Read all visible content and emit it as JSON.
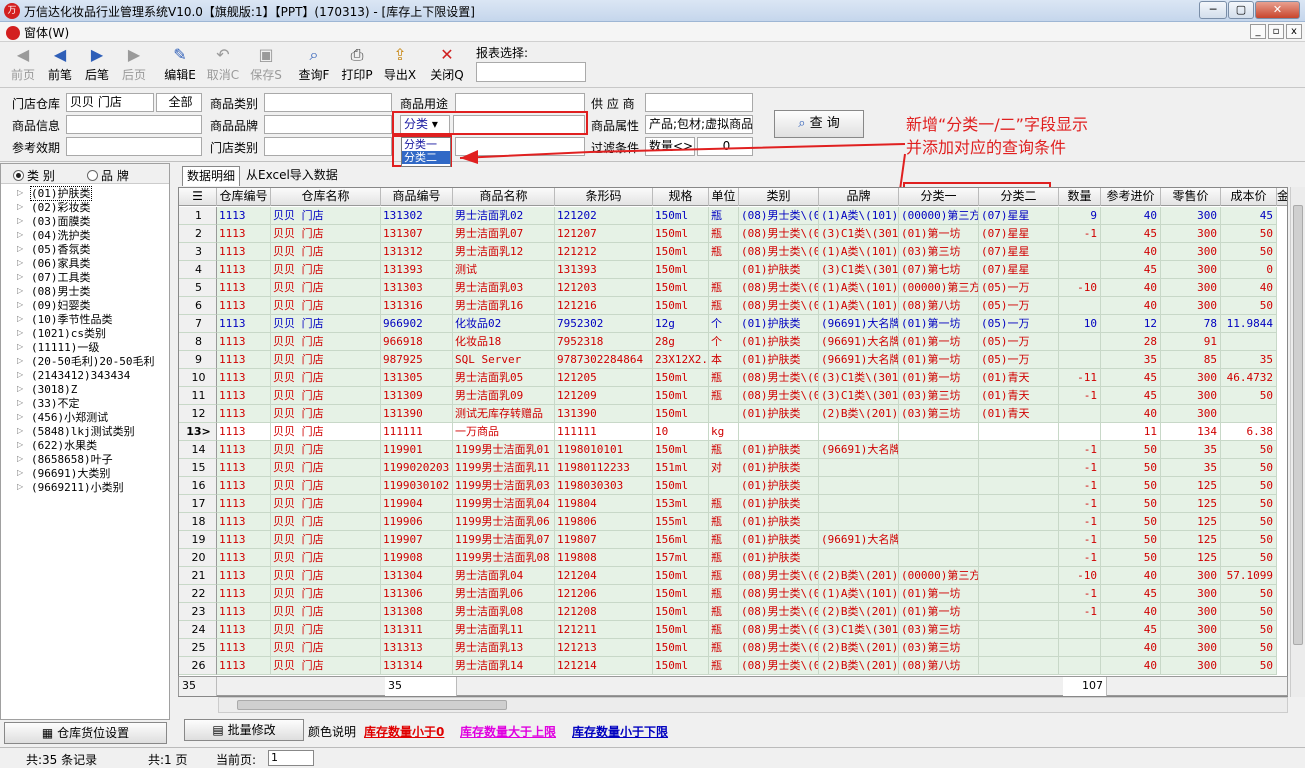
{
  "window": {
    "title": "万信达化妆品行业管理系统V10.0【旗舰版:1】【PPT】(170313) - [库存上下限设置]",
    "controls": [
      "─",
      "▢",
      "✕"
    ]
  },
  "menu": {
    "label": "窗体(W)"
  },
  "toolbar": {
    "buttons": [
      {
        "label": "前页",
        "icon": "first-page-icon"
      },
      {
        "label": "前笔",
        "icon": "prev-icon"
      },
      {
        "label": "后笔",
        "icon": "next-icon"
      },
      {
        "label": "后页",
        "icon": "last-page-icon"
      },
      {
        "label": "编辑E",
        "icon": "edit-icon"
      },
      {
        "label": "取消C",
        "icon": "undo-icon"
      },
      {
        "label": "保存S",
        "icon": "save-icon"
      },
      {
        "label": "查询F",
        "icon": "search-icon"
      },
      {
        "label": "打印P",
        "icon": "print-icon"
      },
      {
        "label": "导出X",
        "icon": "export-icon"
      },
      {
        "label": "关闭Q",
        "icon": "close-icon"
      }
    ],
    "report_label": "报表选择:"
  },
  "filters": {
    "store_label": "门店仓库",
    "store_value": "贝贝 门店",
    "store_all": "全部",
    "goods_info_label": "商品信息",
    "ref_effect_label": "参考效期",
    "category_label": "商品类别",
    "brand_label": "商品品牌",
    "door_category_label": "门店类别",
    "usage_label": "商品用途",
    "class_select_value": "分类",
    "supplier_label": "供 应 商",
    "attr_label": "商品属性",
    "attr_value": "产品;包材;虚拟商品",
    "filter_label": "过滤条件",
    "filter_field": "数量<>",
    "filter_value": "0",
    "query_button": "查 询",
    "dropdown_options": [
      "分类一",
      "分类二"
    ]
  },
  "annotation": {
    "line1": "新增“分类一/二”字段显示",
    "line2": "并添加对应的查询条件"
  },
  "left_panel": {
    "radio_category": "类 别",
    "radio_brand": "品 牌",
    "tree": [
      "(01)护肤类",
      "(02)彩妆类",
      "(03)面膜类",
      "(04)洗护类",
      "(05)香氛类",
      "(06)家具类",
      "(07)工具类",
      "(08)男士类",
      "(09)妇婴类",
      "(10)季节性品类",
      "(1021)cs类别",
      "(11111)一级",
      "(20-50毛利)20-50毛利",
      "(2143412)343434",
      "(3018)Z",
      "(33)不定",
      "(456)小郑测试",
      "(5848)lkj测试类别",
      "(622)水果类",
      "(8658658)叶子",
      "(96691)大类别",
      "(9669211)小类别"
    ],
    "warehouse_button": "仓库货位设置"
  },
  "tabs": [
    "数据明细",
    "从Excel导入数据"
  ],
  "grid": {
    "headers": [
      "仓库编号",
      "仓库名称",
      "商品编号",
      "商品名称",
      "条形码",
      "规格",
      "单位",
      "类别",
      "品牌",
      "分类一",
      "分类二",
      "数量",
      "参考进价",
      "零售价",
      "成本价",
      "金"
    ],
    "rows": [
      [
        "1",
        "1113",
        "贝贝 门店",
        "131302",
        "男士洁面乳02",
        "121202",
        "150ml",
        "瓶",
        "(08)男士类\\(0",
        "(1)A类\\(101)E",
        "(00000)第三方",
        "(07)星星",
        "9",
        "40",
        "300",
        "45"
      ],
      [
        "2",
        "1113",
        "贝贝 门店",
        "131307",
        "男士洁面乳07",
        "121207",
        "150ml",
        "瓶",
        "(08)男士类\\(0",
        "(3)C1类\\(301",
        "(01)第一坊",
        "(07)星星",
        "-1",
        "45",
        "300",
        "50"
      ],
      [
        "3",
        "1113",
        "贝贝 门店",
        "131312",
        "男士洁面乳12",
        "121212",
        "150ml",
        "瓶",
        "(08)男士类\\(0",
        "(1)A类\\(101)E",
        "(03)第三坊",
        "(07)星星",
        "",
        "40",
        "300",
        "50"
      ],
      [
        "4",
        "1113",
        "贝贝 门店",
        "131393",
        "测试",
        "131393",
        "150ml",
        "",
        "(01)护肤类",
        "(3)C1类\\(301",
        "(07)第七坊",
        "(07)星星",
        "",
        "45",
        "300",
        "0"
      ],
      [
        "5",
        "1113",
        "贝贝 门店",
        "131303",
        "男士洁面乳03",
        "121203",
        "150ml",
        "瓶",
        "(08)男士类\\(0",
        "(1)A类\\(101)E",
        "(00000)第三方",
        "(05)一万",
        "-10",
        "40",
        "300",
        "40"
      ],
      [
        "6",
        "1113",
        "贝贝 门店",
        "131316",
        "男士洁面乳16",
        "121216",
        "150ml",
        "瓶",
        "(08)男士类\\(0",
        "(1)A类\\(101)E",
        "(08)第八坊",
        "(05)一万",
        "",
        "40",
        "300",
        "50"
      ],
      [
        "7",
        "1113",
        "贝贝 门店",
        "966902",
        "化妆品02",
        "7952302",
        "12g",
        "个",
        "(01)护肤类",
        "(96691)大名牌",
        "(01)第一坊",
        "(05)一万",
        "10",
        "12",
        "78",
        "11.9844"
      ],
      [
        "8",
        "1113",
        "贝贝 门店",
        "966918",
        "化妆品18",
        "7952318",
        "28g",
        "个",
        "(01)护肤类",
        "(96691)大名牌",
        "(01)第一坊",
        "(05)一万",
        "",
        "28",
        "91",
        ""
      ],
      [
        "9",
        "1113",
        "贝贝 门店",
        "987925",
        "SQL Server",
        "9787302284864",
        "23X12X2.6",
        "本",
        "(01)护肤类",
        "(96691)大名牌",
        "(01)第一坊",
        "(05)一万",
        "",
        "35",
        "85",
        "35"
      ],
      [
        "10",
        "1113",
        "贝贝 门店",
        "131305",
        "男士洁面乳05",
        "121205",
        "150ml",
        "瓶",
        "(08)男士类\\(0",
        "(3)C1类\\(301",
        "(01)第一坊",
        "(01)青天",
        "-11",
        "45",
        "300",
        "46.4732"
      ],
      [
        "11",
        "1113",
        "贝贝 门店",
        "131309",
        "男士洁面乳09",
        "121209",
        "150ml",
        "瓶",
        "(08)男士类\\(0",
        "(3)C1类\\(301",
        "(03)第三坊",
        "(01)青天",
        "-1",
        "45",
        "300",
        "50"
      ],
      [
        "12",
        "1113",
        "贝贝 门店",
        "131390",
        "测试无库存转赠品",
        "131390",
        "150ml",
        "",
        "(01)护肤类",
        "(2)B类\\(201)",
        "(03)第三坊",
        "(01)青天",
        "",
        "40",
        "300",
        ""
      ],
      [
        "13>",
        "1113",
        "贝贝 门店",
        "111111",
        "一万商品",
        "111111",
        "10",
        "kg",
        "",
        "",
        "",
        "",
        "",
        "11",
        "134",
        "6.38"
      ],
      [
        "14",
        "1113",
        "贝贝 门店",
        "119901",
        "1199男士洁面乳01",
        "1198010101",
        "150ml",
        "瓶",
        "(01)护肤类",
        "(96691)大名牌",
        "",
        "",
        "-1",
        "50",
        "35",
        "50"
      ],
      [
        "15",
        "1113",
        "贝贝 门店",
        "1199020203",
        "1199男士洁面乳11",
        "11980112233",
        "151ml",
        "对",
        "(01)护肤类",
        "",
        "",
        "",
        "-1",
        "50",
        "35",
        "50"
      ],
      [
        "16",
        "1113",
        "贝贝 门店",
        "1199030102",
        "1199男士洁面乳03",
        "1198030303",
        "150ml",
        "",
        "(01)护肤类",
        "",
        "",
        "",
        "-1",
        "50",
        "125",
        "50"
      ],
      [
        "17",
        "1113",
        "贝贝 门店",
        "119904",
        "1199男士洁面乳04",
        "119804",
        "153ml",
        "瓶",
        "(01)护肤类",
        "",
        "",
        "",
        "-1",
        "50",
        "125",
        "50"
      ],
      [
        "18",
        "1113",
        "贝贝 门店",
        "119906",
        "1199男士洁面乳06",
        "119806",
        "155ml",
        "瓶",
        "(01)护肤类",
        "",
        "",
        "",
        "-1",
        "50",
        "125",
        "50"
      ],
      [
        "19",
        "1113",
        "贝贝 门店",
        "119907",
        "1199男士洁面乳07",
        "119807",
        "156ml",
        "瓶",
        "(01)护肤类",
        "(96691)大名牌",
        "",
        "",
        "-1",
        "50",
        "125",
        "50"
      ],
      [
        "20",
        "1113",
        "贝贝 门店",
        "119908",
        "1199男士洁面乳08",
        "119808",
        "157ml",
        "瓶",
        "(01)护肤类",
        "",
        "",
        "",
        "-1",
        "50",
        "125",
        "50"
      ],
      [
        "21",
        "1113",
        "贝贝 门店",
        "131304",
        "男士洁面乳04",
        "121204",
        "150ml",
        "瓶",
        "(08)男士类\\(0",
        "(2)B类\\(201)",
        "(00000)第三方",
        "",
        "-10",
        "40",
        "300",
        "57.1099"
      ],
      [
        "22",
        "1113",
        "贝贝 门店",
        "131306",
        "男士洁面乳06",
        "121206",
        "150ml",
        "瓶",
        "(08)男士类\\(0",
        "(1)A类\\(101)E",
        "(01)第一坊",
        "",
        "-1",
        "45",
        "300",
        "50"
      ],
      [
        "23",
        "1113",
        "贝贝 门店",
        "131308",
        "男士洁面乳08",
        "121208",
        "150ml",
        "瓶",
        "(08)男士类\\(0",
        "(2)B类\\(201)",
        "(01)第一坊",
        "",
        "-1",
        "40",
        "300",
        "50"
      ],
      [
        "24",
        "1113",
        "贝贝 门店",
        "131311",
        "男士洁面乳11",
        "121211",
        "150ml",
        "瓶",
        "(08)男士类\\(0",
        "(3)C1类\\(301",
        "(03)第三坊",
        "",
        "",
        "45",
        "300",
        "50"
      ],
      [
        "25",
        "1113",
        "贝贝 门店",
        "131313",
        "男士洁面乳13",
        "121213",
        "150ml",
        "瓶",
        "(08)男士类\\(0",
        "(2)B类\\(201)",
        "(03)第三坊",
        "",
        "",
        "40",
        "300",
        "50"
      ],
      [
        "26",
        "1113",
        "贝贝 门店",
        "131314",
        "男士洁面乳14",
        "121214",
        "150ml",
        "瓶",
        "(08)男士类\\(0",
        "(2)B类\\(201)",
        "(08)第八坊",
        "",
        "",
        "40",
        "300",
        "50"
      ]
    ],
    "row_colors": [
      "blue",
      "red",
      "red",
      "red",
      "red",
      "red",
      "blue",
      "red",
      "red",
      "red",
      "red",
      "red",
      "red",
      "red",
      "red",
      "red",
      "red",
      "red",
      "red",
      "red",
      "red",
      "red",
      "red",
      "red",
      "red",
      "red"
    ],
    "footer_count": "35",
    "footer_goods": "35",
    "footer_qty": "107"
  },
  "bottom": {
    "batch_button": "批量修改",
    "legend_label": "颜色说明",
    "legend1": "库存数量小于0",
    "legend2": "库存数量大于上限",
    "legend3": "库存数量小于下限",
    "legend1_color": "#e00000",
    "legend2_color": "#e000e0",
    "legend3_color": "#0000c0"
  },
  "status": {
    "records": "共:35 条记录",
    "pages": "共:1 页",
    "current_label": "当前页:",
    "current_value": "1"
  }
}
